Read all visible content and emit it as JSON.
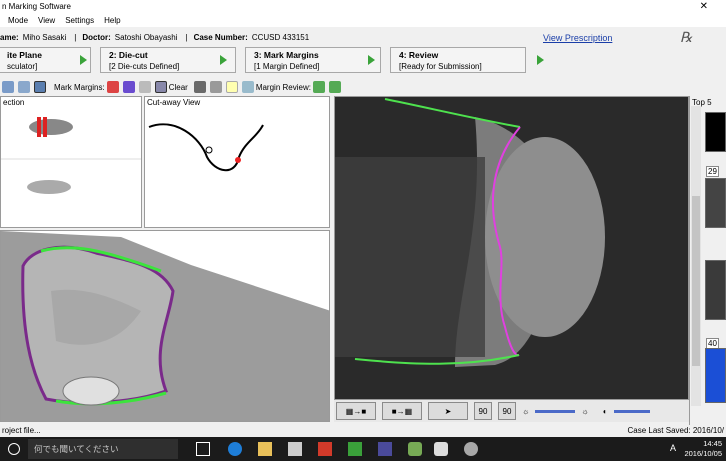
{
  "window": {
    "title": "n Marking Software",
    "close": "✕"
  },
  "menu": [
    "Mode",
    "View",
    "Settings",
    "Help"
  ],
  "info": {
    "name_label": "ame:",
    "name": "Miho Sasaki",
    "doctor_label": "Doctor:",
    "doctor": "Satoshi Obayashi",
    "case_label": "Case Number:",
    "case": "CCUSD 433151",
    "view_prescription": "View Prescription",
    "rx": "℞"
  },
  "steps": [
    {
      "title": "ite Plane",
      "sub": "sculator]"
    },
    {
      "title": "2: Die-cut",
      "sub": "[2 Die-cuts Defined]"
    },
    {
      "title": "3: Mark Margins",
      "sub": "[1 Margin Defined]"
    },
    {
      "title": "4: Review",
      "sub": "[Ready for Submission]"
    }
  ],
  "toolbar": {
    "mark_margins": "Mark Margins:",
    "clear": "Clear",
    "margin_review": "Margin Review:"
  },
  "panels": {
    "section": "ection",
    "cutaway": "Cut-away View",
    "top5": "Top 5"
  },
  "thumbs": [
    "29",
    "40"
  ],
  "bottombar": {
    "rot1": "90",
    "rot2": "90"
  },
  "status": {
    "left": "roject file...",
    "right": "Case Last Saved: 2016/10/"
  },
  "taskbar": {
    "search": "何でも聞いてください",
    "time": "14:45",
    "date": "2016/10/05",
    "lang": "A"
  }
}
